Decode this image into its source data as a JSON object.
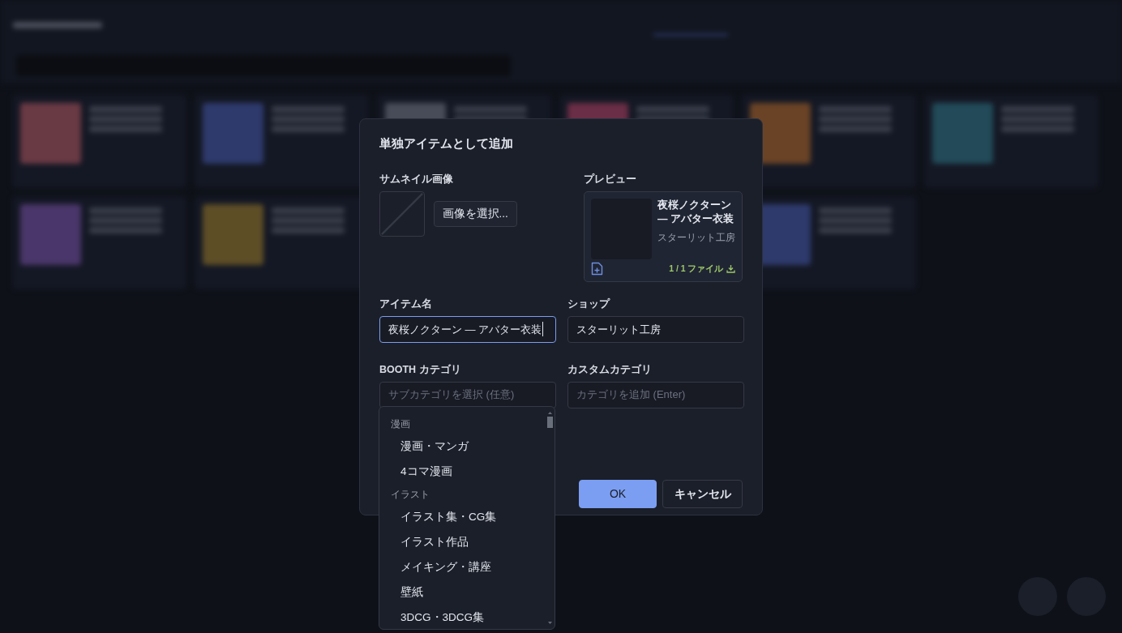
{
  "dialog": {
    "title": "単独アイテムとして追加",
    "thumbnail": {
      "label": "サムネイル画像",
      "button": "画像を選択..."
    },
    "preview": {
      "label": "プレビュー",
      "name": "夜桜ノクターン — アバター衣装",
      "shop": "スターリット工房",
      "files": "1 / 1 ファイル"
    },
    "fields": [
      {
        "label": "アイテム名",
        "value": "夜桜ノクターン — アバター衣装",
        "focused": true
      },
      {
        "label": "ショップ",
        "value": "スターリット工房",
        "focused": false
      },
      {
        "label": "BOOTH カテゴリ",
        "placeholder": "サブカテゴリを選択 (任意)",
        "focused": false
      },
      {
        "label": "カスタムカテゴリ",
        "placeholder": "カテゴリを追加 (Enter)",
        "focused": false
      }
    ],
    "buttons": [
      {
        "label": "OK",
        "kind": "primary"
      },
      {
        "label": "キャンセル",
        "kind": "secondary"
      }
    ]
  },
  "dropdown": {
    "groups": [
      {
        "label": "漫画",
        "items": [
          "漫画・マンガ",
          "4コマ漫画"
        ]
      },
      {
        "label": "イラスト",
        "items": [
          "イラスト集・CG集",
          "イラスト作品",
          "メイキング・講座",
          "壁紙",
          "3DCG・3DCG集"
        ]
      }
    ]
  }
}
